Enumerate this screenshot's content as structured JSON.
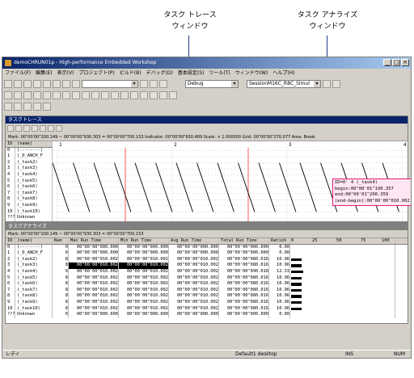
{
  "callouts": {
    "trace": "タスク トレース\nウィンドウ",
    "analyze": "タスク アナライズ\nウィンドウ"
  },
  "app": {
    "title": "demoCHRUN01p - High-performance Embedded Workshop",
    "window_buttons": [
      "_",
      "□",
      "×"
    ]
  },
  "menu": [
    "ファイル(F)",
    "編集(E)",
    "表示(V)",
    "プロジェクト(P)",
    "ビルド(B)",
    "デバッグ(D)",
    "基本設定(S)",
    "ツール(T)",
    "ウィンドウ(W)",
    "ヘルプ(H)"
  ],
  "toolbar": {
    "debug_combo": "Debug",
    "session_combo": "SessionM16C_R8C_Simul"
  },
  "trace": {
    "title": "タスクトレース",
    "status": "Mark: 00\"00'00\"200.149 ~ 00\"00'00\"930.303 = 00\"00'00\"700.153   Indicator: 00\"00'00\"930.489   Scale: × 1.000000   Grid: 00\"00'00\"270.077   Area: Break",
    "header": [
      "ID",
      "(name)"
    ],
    "rows": [
      [
        "0",
        "(--------)"
      ],
      [
        "1",
        "(_D_ANCH_F"
      ],
      [
        "2",
        "(_task2)"
      ],
      [
        "3",
        "(_task3)"
      ],
      [
        "4",
        "(_task4)"
      ],
      [
        "5",
        "(_task5)"
      ],
      [
        "6",
        "(_task6)"
      ],
      [
        "7",
        "(_task7)"
      ],
      [
        "8",
        "(_task8)"
      ],
      [
        "9",
        "(_task9)"
      ],
      [
        "10",
        "(_task10)"
      ],
      [
        "???",
        "Unknown"
      ]
    ],
    "markers": [
      "1",
      "2",
      "3",
      "4"
    ],
    "popup": [
      "ID=0'   4 (_task4)",
      "begin:00\"00'01\"190.357",
      "end:00\"00'01\"200.359",
      "(end-begin):00\"00'00\"010.002"
    ]
  },
  "analyze": {
    "title": "タスクアナライズ",
    "status": "Mark: 00\"00'00\"200.149 ~ 00\"00'00\"930.303 = 00\"00'00\"700.153",
    "header": [
      "ID",
      "(name)",
      "Num",
      "Max Run Time",
      "Min Run Time",
      "Avg Run Time",
      "Total Run Time",
      "Ratio%"
    ],
    "scale": [
      "0",
      "25",
      "50",
      "75",
      "100"
    ],
    "rows": [
      [
        "0",
        "(--------)",
        "0",
        "00\"00'00\"000.000",
        "00\"00'00\"000.000",
        "00\"00'00\"000.000",
        "00\"00'00\"000.000",
        "0.00"
      ],
      [
        "1",
        "(_D_ANCH_F",
        "0",
        "00\"00'00\"000.000",
        "00\"00'00\"000.000",
        "00\"00'00\"000.000",
        "00\"00'00\"000.000",
        "0.00"
      ],
      [
        "2",
        "(_task2)",
        "8",
        "00\"00'00\"010.002",
        "00\"00'00\"010.002",
        "00\"00'00\"010.002",
        "00\"00'00\"080.016",
        "10.96"
      ],
      [
        "3",
        "(_task3)",
        "8",
        "00\"00'00\"010.002",
        "00\"00'00\"010.002",
        "00\"00'00\"010.002",
        "00\"00'00\"080.016",
        "10.96"
      ],
      [
        "4",
        "(_task4)",
        "9",
        "00\"00'00\"010.002",
        "00\"00'00\"010.002",
        "00\"00'00\"010.002",
        "00\"00'00\"090.018",
        "12.33"
      ],
      [
        "5",
        "(_task5)",
        "8",
        "00\"00'00\"010.002",
        "00\"00'00\"010.002",
        "00\"00'00\"010.002",
        "00\"00'00\"080.016",
        "10.96"
      ],
      [
        "6",
        "(_task6)",
        "8",
        "00\"00'00\"010.002",
        "00\"00'00\"010.002",
        "00\"00'00\"010.002",
        "00\"00'00\"080.016",
        "10.96"
      ],
      [
        "7",
        "(_task7)",
        "8",
        "00\"00'00\"010.002",
        "00\"00'00\"010.002",
        "00\"00'00\"010.002",
        "00\"00'00\"080.016",
        "10.96"
      ],
      [
        "8",
        "(_task8)",
        "8",
        "00\"00'00\"010.002",
        "00\"00'00\"010.002",
        "00\"00'00\"010.002",
        "00\"00'00\"080.016",
        "10.96"
      ],
      [
        "9",
        "(_task9)",
        "8",
        "00\"00'00\"010.002",
        "00\"00'00\"010.002",
        "00\"00'00\"010.002",
        "00\"00'00\"080.016",
        "10.96"
      ],
      [
        "10",
        "(_task10)",
        "8",
        "00\"00'00\"010.002",
        "00\"00'00\"010.002",
        "00\"00'00\"010.002",
        "00\"00'00\"080.016",
        "10.96"
      ],
      [
        "???",
        "Unknown",
        "0",
        "00\"00'00\"000.000",
        "00\"00'00\"000.000",
        "00\"00'00\"000.000",
        "00\"00'00\"000.000",
        "0.00"
      ]
    ],
    "selected_row": 3
  },
  "statusbar": {
    "left": "レディ",
    "desktop": "Default1 desktop",
    "ins": "INS",
    "num": "NUM"
  },
  "colors": {
    "title_bar": "#0a246a",
    "accent_red": "#e0207a",
    "popup_bg": "#ffe6f2",
    "mark_line": "#ff3030"
  }
}
